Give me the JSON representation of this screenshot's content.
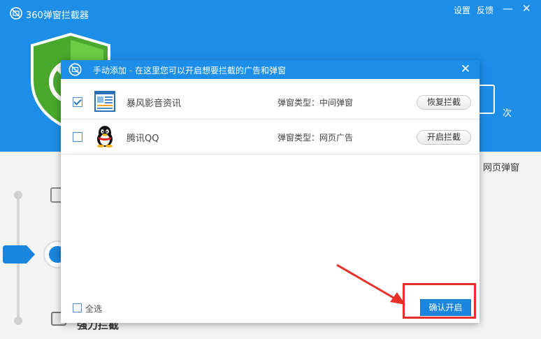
{
  "app": {
    "title": "360弹窗拦截器",
    "menu": {
      "settings": "设置",
      "feedback": "反馈"
    },
    "window_controls": {
      "minimize": "—",
      "close": "✕"
    },
    "count_unit": "次",
    "right_panel_label": "网页弹窗",
    "bg_item_label": "强力拦截"
  },
  "dialog": {
    "title": "手动添加 - 在这里您可以开启想要拦截的广告和弹窗",
    "close": "✕",
    "rows": [
      {
        "checked": true,
        "name": "暴风影音资讯",
        "type": "弹窗类型：中间弹窗",
        "action": "恢复拦截",
        "icon": "news-app-icon"
      },
      {
        "checked": false,
        "name": "腾讯QQ",
        "type": "弹窗类型：网页广告",
        "action": "开启拦截",
        "icon": "qq-penguin-icon"
      }
    ],
    "select_all": "全选",
    "confirm": "确认开启"
  },
  "colors": {
    "primary": "#1c8ee8",
    "confirm_button": "#1a86e0",
    "annotation_red": "#e8302a",
    "shield_green": "#5bbd3a"
  }
}
